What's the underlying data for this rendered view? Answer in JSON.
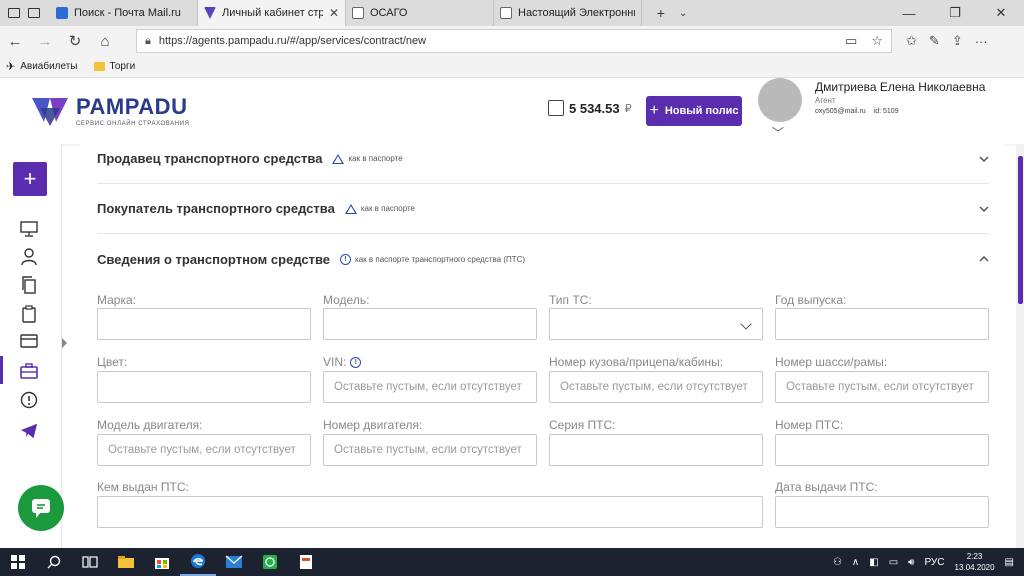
{
  "browser": {
    "tabs": [
      {
        "title": "Поиск - Почта Mail.ru",
        "active": false,
        "color": "#2a6bd6"
      },
      {
        "title": "Личный кабинет страх",
        "active": true,
        "color": "#3b4bb0"
      },
      {
        "title": "ОСАГО",
        "active": false,
        "color": "#888888"
      },
      {
        "title": "Настоящий Электронный I",
        "active": false,
        "color": "#888888"
      }
    ],
    "url": "https://agents.pampadu.ru/#/app/services/contract/new",
    "bookmarks": [
      "Авиабилеты",
      "Торги"
    ]
  },
  "header": {
    "logo_name": "PAMPADU",
    "logo_sub": "СЕРВИС ОНЛАЙН СТРАХОВАНИЯ",
    "balance": "5 534.53",
    "currency": "₽",
    "new_policy_label": "Новый полис",
    "user_name": "Дмитриева Елена Николаевна",
    "user_role": "Агент",
    "user_email": "oxy505@mail.ru",
    "user_id": "id: 5109"
  },
  "sections": [
    {
      "title": "Продавец транспортного средства",
      "hint": "как в паспорте",
      "hint_icon": "warning-icon",
      "expanded": false
    },
    {
      "title": "Покупатель транспортного средства",
      "hint": "как в паспорте",
      "hint_icon": "warning-icon",
      "expanded": false
    },
    {
      "title": "Сведения о транспортном средстве",
      "hint": "как в паспорте транспортного средства (ПТС)",
      "hint_icon": "info-icon",
      "expanded": true
    }
  ],
  "fields": {
    "make": {
      "label": "Марка:",
      "value": ""
    },
    "model": {
      "label": "Модель:",
      "value": ""
    },
    "vehicle_type": {
      "label": "Тип ТС:",
      "value": ""
    },
    "year": {
      "label": "Год выпуска:",
      "value": ""
    },
    "color": {
      "label": "Цвет:",
      "value": ""
    },
    "vin": {
      "label": "VIN:",
      "placeholder": "Оставьте пустым, если отсутствует"
    },
    "body_number": {
      "label": "Номер кузова/прицепа/кабины:",
      "placeholder": "Оставьте пустым, если отсутствует"
    },
    "chassis_number": {
      "label": "Номер шасси/рамы:",
      "placeholder": "Оставьте пустым, если отсутствует"
    },
    "engine_model": {
      "label": "Модель двигателя:",
      "placeholder": "Оставьте пустым, если отсутствует"
    },
    "engine_number": {
      "label": "Номер двигателя:",
      "placeholder": "Оставьте пустым, если отсутствует"
    },
    "pts_series": {
      "label": "Серия ПТС:",
      "value": ""
    },
    "pts_number": {
      "label": "Номер ПТС:",
      "value": ""
    },
    "pts_issuer": {
      "label": "Кем выдан ПТС:",
      "value": ""
    },
    "pts_date": {
      "label": "Дата выдачи ПТС:",
      "value": ""
    }
  },
  "taskbar": {
    "lang": "РУС",
    "time": "2:23",
    "date": "13.04.2020"
  },
  "colors": {
    "brand": "#5a2dae",
    "accent_blue": "#2a4aa8",
    "chat_green": "#1a9a3c"
  }
}
